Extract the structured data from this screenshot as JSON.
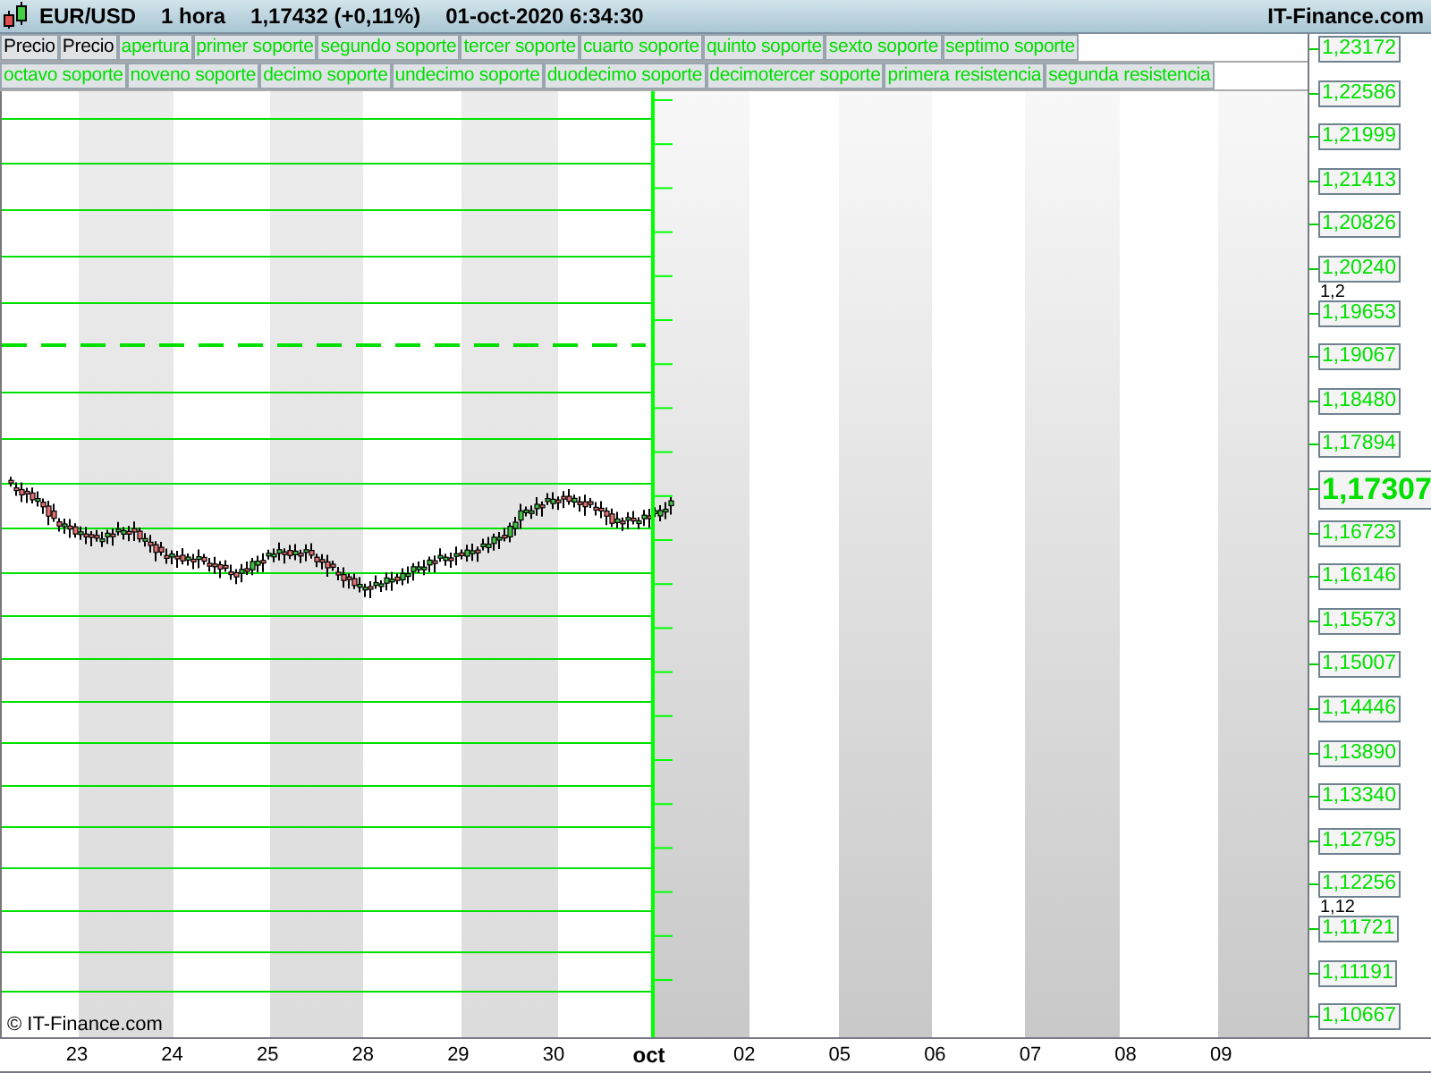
{
  "header": {
    "symbol": "EUR/USD",
    "interval": "1 hora",
    "quote": "1,17432 (+0,11%)",
    "datetime": "01-oct-2020 6:34:30",
    "brand": "IT-Finance.com"
  },
  "legend": {
    "rows": [
      {
        "items": [
          {
            "label": "Precio",
            "color": "#000000"
          },
          {
            "label": "Precio",
            "color": "#000000"
          },
          {
            "label": "apertura",
            "color": "#00dd00"
          },
          {
            "label": "primer soporte",
            "color": "#00dd00"
          },
          {
            "label": "segundo soporte",
            "color": "#00dd00"
          },
          {
            "label": "tercer soporte",
            "color": "#00dd00"
          },
          {
            "label": "cuarto soporte",
            "color": "#00dd00"
          },
          {
            "label": "quinto soporte",
            "color": "#00dd00"
          },
          {
            "label": "sexto soporte",
            "color": "#00dd00"
          },
          {
            "label": "septimo soporte",
            "color": "#00dd00"
          }
        ]
      },
      {
        "items": [
          {
            "label": "octavo soporte",
            "color": "#00dd00"
          },
          {
            "label": "noveno soporte",
            "color": "#00dd00"
          },
          {
            "label": "decimo soporte",
            "color": "#00dd00"
          },
          {
            "label": "undecimo soporte",
            "color": "#00dd00"
          },
          {
            "label": "duodecimo soporte",
            "color": "#00dd00"
          },
          {
            "label": "decimotercer soporte",
            "color": "#00dd00"
          },
          {
            "label": "primera resistencia",
            "color": "#00dd00"
          },
          {
            "label": "segunda resistencia",
            "color": "#00dd00"
          }
        ]
      }
    ]
  },
  "chart": {
    "credit": "© IT-Finance.com"
  },
  "price_axis": {
    "ticks": [
      {
        "label": "1,2"
      },
      {
        "label": "1,12"
      }
    ],
    "levels": [
      {
        "label": "1,23172",
        "kind": "level"
      },
      {
        "label": "1,22586",
        "kind": "level"
      },
      {
        "label": "1,21999",
        "kind": "level"
      },
      {
        "label": "1,21413",
        "kind": "level"
      },
      {
        "label": "1,20826",
        "kind": "level"
      },
      {
        "label": "1,20240",
        "kind": "level"
      },
      {
        "label": "1,19653",
        "kind": "level"
      },
      {
        "label": "1,19067",
        "kind": "level"
      },
      {
        "label": "1,18480",
        "kind": "level"
      },
      {
        "label": "1,17894",
        "kind": "level"
      },
      {
        "label": "1,17307",
        "kind": "current"
      },
      {
        "label": "1,16723",
        "kind": "level"
      },
      {
        "label": "1,16146",
        "kind": "level"
      },
      {
        "label": "1,15573",
        "kind": "level"
      },
      {
        "label": "1,15007",
        "kind": "level"
      },
      {
        "label": "1,14446",
        "kind": "level"
      },
      {
        "label": "1,13890",
        "kind": "level"
      },
      {
        "label": "1,13340",
        "kind": "level"
      },
      {
        "label": "1,12795",
        "kind": "level"
      },
      {
        "label": "1,12256",
        "kind": "level"
      },
      {
        "label": "1,11721",
        "kind": "level"
      },
      {
        "label": "1,11191",
        "kind": "level"
      },
      {
        "label": "1,10667",
        "kind": "level"
      }
    ]
  },
  "time_axis": {
    "labels": [
      {
        "label": "23",
        "kind": "day"
      },
      {
        "label": "24",
        "kind": "day"
      },
      {
        "label": "25",
        "kind": "day"
      },
      {
        "label": "28",
        "kind": "day"
      },
      {
        "label": "29",
        "kind": "day"
      },
      {
        "label": "30",
        "kind": "day"
      },
      {
        "label": "oct",
        "kind": "month"
      },
      {
        "label": "02",
        "kind": "day"
      },
      {
        "label": "05",
        "kind": "day"
      },
      {
        "label": "06",
        "kind": "day"
      },
      {
        "label": "07",
        "kind": "day"
      },
      {
        "label": "08",
        "kind": "day"
      },
      {
        "label": "09",
        "kind": "day"
      }
    ]
  }
}
